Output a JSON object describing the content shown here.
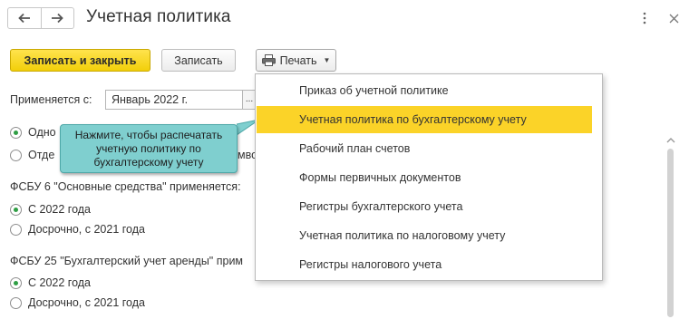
{
  "header": {
    "title": "Учетная политика",
    "back_icon": "arrow-left-icon",
    "forward_icon": "arrow-right-icon",
    "more_icon": "more-vertical-icon",
    "close_icon": "close-icon"
  },
  "toolbar": {
    "save_close_label": "Записать и закрыть",
    "save_label": "Записать",
    "print_label": "Печать",
    "print_icon": "printer-icon",
    "accent_color": "#f7d917"
  },
  "form": {
    "applies_label": "Применяется с:",
    "applies_value": "Январь 2022 г.",
    "applies_button": "...",
    "top_radio_1": "Одно",
    "top_radio_2": "Отде",
    "top_radio_2_tail": "мво",
    "fsbu6_label": "ФСБУ 6 \"Основные средства\" применяется:",
    "fsbu6_opt1": "С 2022 года",
    "fsbu6_opt2": "Досрочно, с 2021 года",
    "fsbu25_label": "ФСБУ 25 \"Бухгалтерский учет аренды\" прим",
    "fsbu25_opt1": "С 2022 года",
    "fsbu25_opt2": "Досрочно, с 2021 года"
  },
  "callout": {
    "text": "Нажмите, чтобы распечатать учетную политику по бухгалтерскому учету"
  },
  "print_menu": {
    "items": [
      {
        "label": "Приказ об учетной политике"
      },
      {
        "label": "Учетная политика по бухгалтерскому учету",
        "active": true
      },
      {
        "label": "Рабочий план счетов"
      },
      {
        "label": "Формы первичных документов"
      },
      {
        "label": "Регистры бухгалтерского учета"
      },
      {
        "label": "Учетная политика по налоговому учету"
      },
      {
        "label": "Регистры налогового учета"
      }
    ],
    "highlight_color": "#fbd328"
  }
}
